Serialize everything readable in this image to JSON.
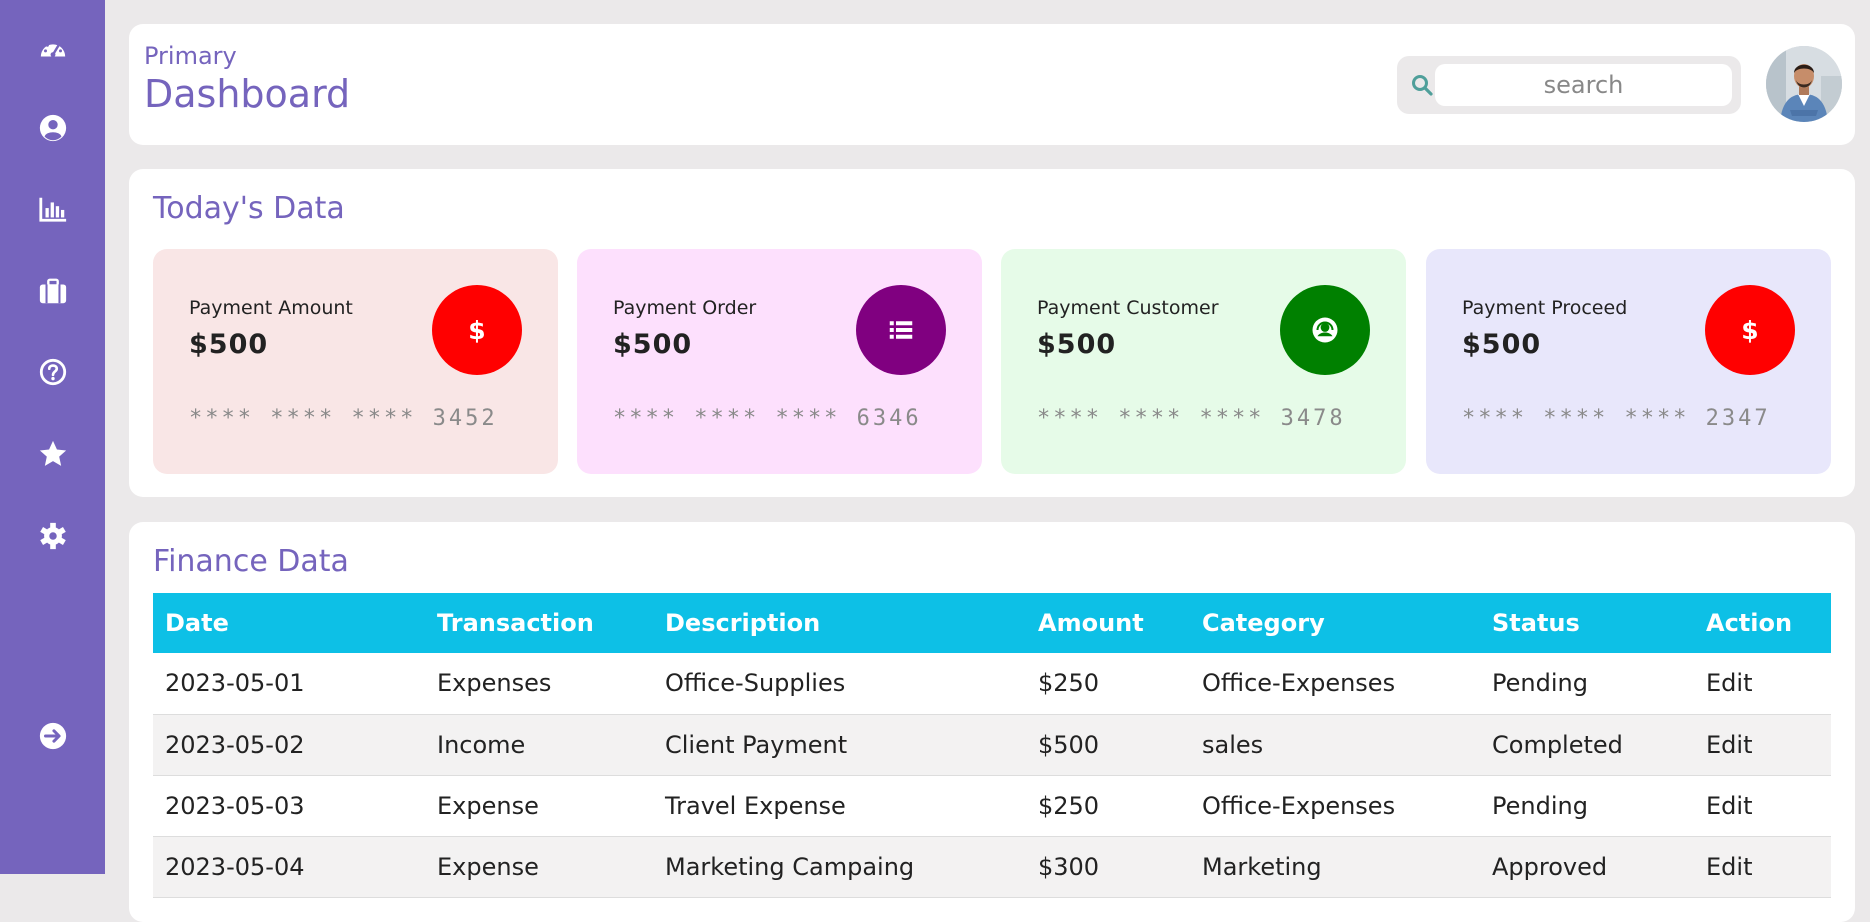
{
  "colors": {
    "sidebar": "#7564bd",
    "accent": "#7564bd",
    "table_header": "#0dc0e6",
    "red": "#ff0000",
    "purple": "#800080",
    "green": "#008000"
  },
  "sidebar": {
    "items": [
      {
        "icon": "dashboard-gauge-icon"
      },
      {
        "icon": "user-circle-icon"
      },
      {
        "icon": "bar-chart-icon"
      },
      {
        "icon": "briefcase-icon"
      },
      {
        "icon": "help-circle-icon"
      },
      {
        "icon": "star-icon"
      },
      {
        "icon": "gear-icon"
      }
    ],
    "bottom_icon": "arrow-right-circle-icon"
  },
  "header": {
    "subtitle": "Primary",
    "title": "Dashboard",
    "search": {
      "value": "search",
      "icon": "search-icon"
    },
    "avatar_icon": "user-avatar"
  },
  "today": {
    "title": "Today's Data",
    "cards": [
      {
        "label": "Payment Amount",
        "amount": "$500",
        "number": "**** **** **** 3452",
        "icon": "dollar-icon",
        "bg": "#f9e6e6",
        "circle": "#ff0000"
      },
      {
        "label": "Payment Order",
        "amount": "$500",
        "number": "**** **** **** 6346",
        "icon": "list-icon",
        "bg": "#fde0fd",
        "circle": "#800080"
      },
      {
        "label": "Payment Customer",
        "amount": "$500",
        "number": "**** **** **** 3478",
        "icon": "headset-icon",
        "bg": "#e6fbe8",
        "circle": "#008000"
      },
      {
        "label": "Payment Proceed",
        "amount": "$500",
        "number": "**** **** **** 2347",
        "icon": "dollar-icon",
        "bg": "#e8e7fb",
        "circle": "#ff0000"
      }
    ]
  },
  "finance": {
    "title": "Finance Data",
    "columns": [
      "Date",
      "Transaction",
      "Description",
      "Amount",
      "Category",
      "Status",
      "Action"
    ],
    "rows": [
      [
        "2023-05-01",
        "Expenses",
        "Office-Supplies",
        "$250",
        "Office-Expenses",
        "Pending",
        "Edit"
      ],
      [
        "2023-05-02",
        "Income",
        "Client Payment",
        "$500",
        "sales",
        "Completed",
        "Edit"
      ],
      [
        "2023-05-03",
        "Expense",
        "Travel Expense",
        "$250",
        "Office-Expenses",
        "Pending",
        "Edit"
      ],
      [
        "2023-05-04",
        "Expense",
        "Marketing Campaing",
        "$300",
        "Marketing",
        "Approved",
        "Edit"
      ]
    ]
  }
}
